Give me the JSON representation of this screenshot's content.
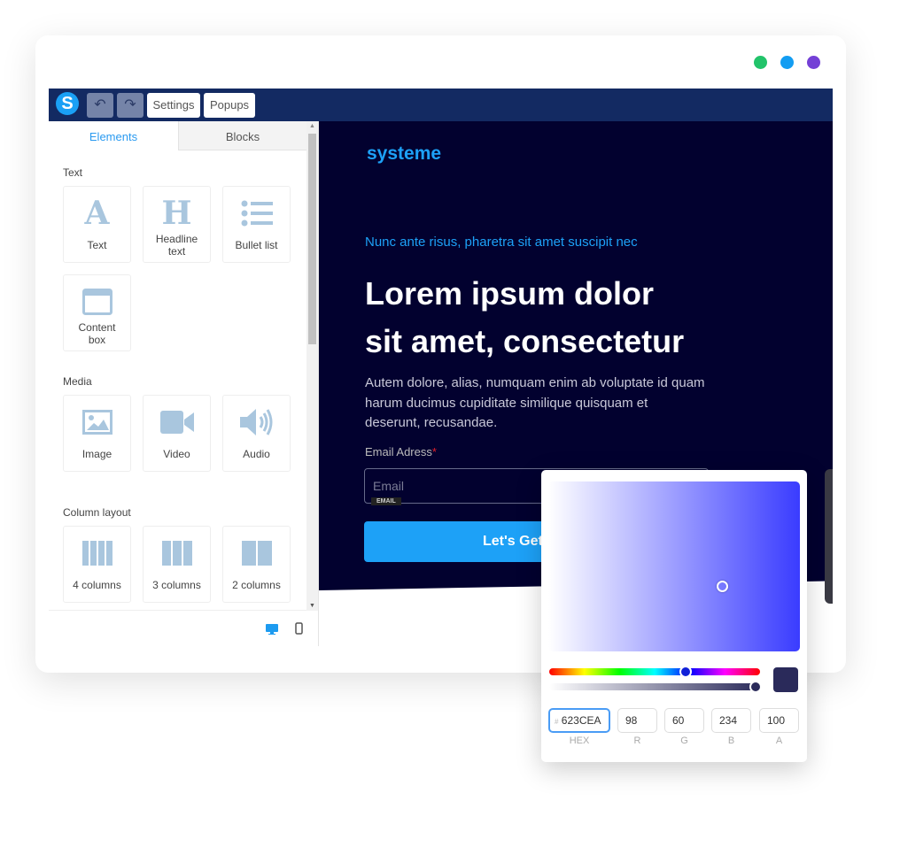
{
  "window": {
    "dots": [
      "#22c36a",
      "#139df2",
      "#7440d6"
    ]
  },
  "toolbar": {
    "logo": "S",
    "undo_icon": "undo-icon",
    "redo_icon": "redo-icon",
    "settings": "Settings",
    "popups": "Popups"
  },
  "sidebar": {
    "tabs": [
      {
        "label": "Elements",
        "active": true
      },
      {
        "label": "Blocks"
      }
    ],
    "sections": {
      "text": "Text",
      "media": "Media",
      "columns": "Column layout"
    },
    "text_items": [
      {
        "label": "Text",
        "icon": "letter-a-icon"
      },
      {
        "label": "Headline text",
        "icon": "letter-h-icon"
      },
      {
        "label": "Bullet list",
        "icon": "bullet-list-icon"
      },
      {
        "label": "Content box",
        "icon": "content-box-icon"
      }
    ],
    "media_items": [
      {
        "label": "Image",
        "icon": "image-icon"
      },
      {
        "label": "Video",
        "icon": "video-icon"
      },
      {
        "label": "Audio",
        "icon": "audio-icon"
      }
    ],
    "column_items": [
      {
        "label": "4 columns",
        "icon": "four-columns-icon"
      },
      {
        "label": "3 columns",
        "icon": "three-columns-icon"
      },
      {
        "label": "2 columns",
        "icon": "two-columns-icon"
      }
    ],
    "devices": [
      "desktop-icon",
      "mobile-icon"
    ]
  },
  "page": {
    "brand": "systeme",
    "tagline": "Nunc ante risus, pharetra sit amet suscipit nec",
    "headline1": "Lorem ipsum dolor",
    "headline2": "sit amet, consectetur",
    "body": "Autem dolore, alias, numquam enim ab voluptate id quam harum ducimus cupiditate similique quisquam et deserunt, recusandae.",
    "email_label": "Email Adress",
    "required": "*",
    "email_placeholder": "Email",
    "email_tag": "EMAIL",
    "cta": "Let's Get",
    "accent": "#1da1f7",
    "bg": "#02012f"
  },
  "picker": {
    "hex": "623CEA",
    "r": "98",
    "g": "60",
    "b": "234",
    "a": "100",
    "labels": {
      "hex": "HEX",
      "r": "R",
      "g": "G",
      "b": "B",
      "a": "A"
    },
    "hash": "#",
    "swatch": "#2a2a5a"
  }
}
